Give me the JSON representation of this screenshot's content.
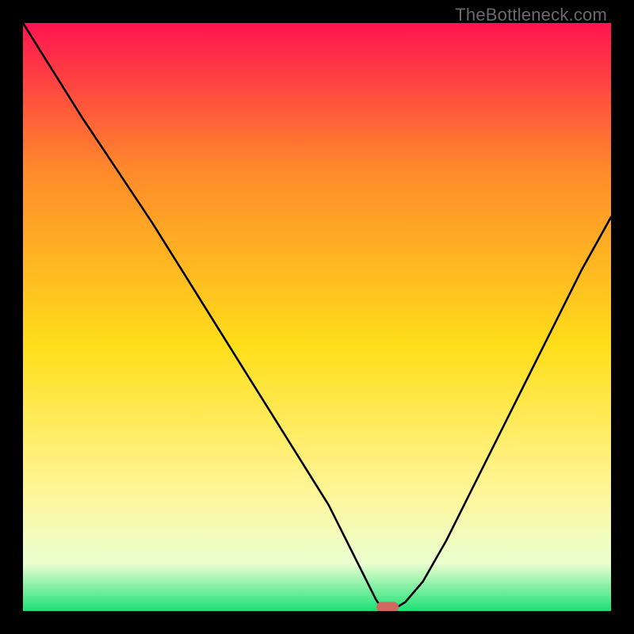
{
  "watermark": "TheBottleneck.com",
  "colors": {
    "top": "#ff1450",
    "mid_high": "#ff8a2b",
    "mid": "#ffde1a",
    "mid_low": "#fff69a",
    "low": "#e9ffd0",
    "bottom": "#1be076",
    "marker": "#d2695e",
    "curve": "#000000",
    "frame": "#000000"
  },
  "chart_data": {
    "type": "line",
    "title": "",
    "xlabel": "",
    "ylabel": "",
    "xlim": [
      0,
      100
    ],
    "ylim": [
      0,
      100
    ],
    "x": [
      0,
      5,
      10,
      14,
      18,
      22,
      27,
      32,
      37,
      42,
      47,
      52,
      55,
      58,
      60,
      61,
      62,
      63,
      65,
      68,
      72,
      76,
      80,
      85,
      90,
      95,
      100
    ],
    "values": [
      100,
      92,
      84,
      78,
      72,
      66,
      58,
      50,
      42,
      34,
      26,
      18,
      12,
      6,
      2,
      0.5,
      0.3,
      0.3,
      1.5,
      5,
      12,
      20,
      28,
      38,
      48,
      58,
      67
    ],
    "marker_point": {
      "x": 62,
      "y": 0.3
    },
    "legend": false,
    "grid": false
  }
}
